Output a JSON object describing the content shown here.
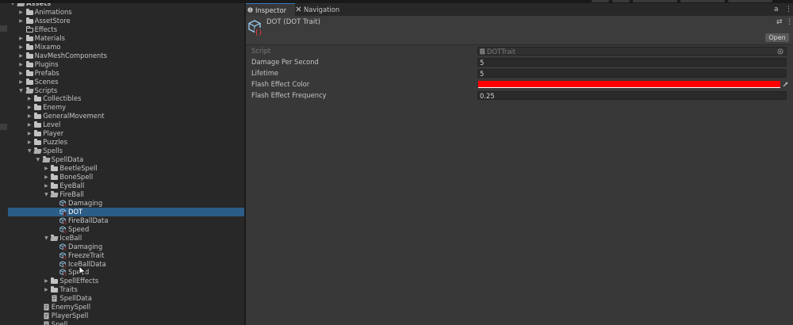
{
  "project": {
    "rows": [
      {
        "label": "Assets",
        "depth": 0,
        "arrow": "down",
        "icon": "folder-open-icon",
        "bold": true
      },
      {
        "label": "Animations",
        "depth": 1,
        "arrow": "right",
        "icon": "folder-icon"
      },
      {
        "label": "AssetStore",
        "depth": 1,
        "arrow": "right",
        "icon": "folder-icon"
      },
      {
        "label": "Effects",
        "depth": 1,
        "arrow": "",
        "icon": "folder-empty-icon"
      },
      {
        "label": "Materials",
        "depth": 1,
        "arrow": "right",
        "icon": "folder-icon"
      },
      {
        "label": "Mixamo",
        "depth": 1,
        "arrow": "right",
        "icon": "folder-icon"
      },
      {
        "label": "NavMeshComponents",
        "depth": 1,
        "arrow": "right",
        "icon": "folder-icon"
      },
      {
        "label": "Plugins",
        "depth": 1,
        "arrow": "right",
        "icon": "folder-icon"
      },
      {
        "label": "Prefabs",
        "depth": 1,
        "arrow": "right",
        "icon": "folder-icon"
      },
      {
        "label": "Scenes",
        "depth": 1,
        "arrow": "right",
        "icon": "folder-icon"
      },
      {
        "label": "Scripts",
        "depth": 1,
        "arrow": "down",
        "icon": "folder-open-icon"
      },
      {
        "label": "Collectibles",
        "depth": 2,
        "arrow": "right",
        "icon": "folder-icon"
      },
      {
        "label": "Enemy",
        "depth": 2,
        "arrow": "right",
        "icon": "folder-icon"
      },
      {
        "label": "GeneralMovement",
        "depth": 2,
        "arrow": "right",
        "icon": "folder-icon"
      },
      {
        "label": "Level",
        "depth": 2,
        "arrow": "right",
        "icon": "folder-icon"
      },
      {
        "label": "Player",
        "depth": 2,
        "arrow": "right",
        "icon": "folder-icon"
      },
      {
        "label": "Puzzles",
        "depth": 2,
        "arrow": "right",
        "icon": "folder-icon"
      },
      {
        "label": "Spells",
        "depth": 2,
        "arrow": "down",
        "icon": "folder-open-icon"
      },
      {
        "label": "SpellData",
        "depth": 3,
        "arrow": "down",
        "icon": "folder-open-icon"
      },
      {
        "label": "BeetleSpell",
        "depth": 4,
        "arrow": "right",
        "icon": "folder-icon"
      },
      {
        "label": "BoneSpell",
        "depth": 4,
        "arrow": "right",
        "icon": "folder-icon"
      },
      {
        "label": "EyeBall",
        "depth": 4,
        "arrow": "right",
        "icon": "folder-icon"
      },
      {
        "label": "FireBall",
        "depth": 4,
        "arrow": "down",
        "icon": "folder-open-icon"
      },
      {
        "label": "Damaging",
        "depth": 5,
        "arrow": "",
        "icon": "scriptable-object-icon"
      },
      {
        "label": "DOT",
        "depth": 5,
        "arrow": "",
        "icon": "scriptable-object-icon",
        "selected": true
      },
      {
        "label": "FireBallData",
        "depth": 5,
        "arrow": "",
        "icon": "scriptable-object-icon"
      },
      {
        "label": "Speed",
        "depth": 5,
        "arrow": "",
        "icon": "scriptable-object-icon"
      },
      {
        "label": "IceBall",
        "depth": 4,
        "arrow": "down",
        "icon": "folder-open-icon"
      },
      {
        "label": "Damaging",
        "depth": 5,
        "arrow": "",
        "icon": "scriptable-object-icon"
      },
      {
        "label": "FreezeTrait",
        "depth": 5,
        "arrow": "",
        "icon": "scriptable-object-icon"
      },
      {
        "label": "IceBallData",
        "depth": 5,
        "arrow": "",
        "icon": "scriptable-object-icon"
      },
      {
        "label": "Speed",
        "depth": 5,
        "arrow": "",
        "icon": "scriptable-object-icon"
      },
      {
        "label": "SpellEffects",
        "depth": 4,
        "arrow": "right",
        "icon": "folder-icon"
      },
      {
        "label": "Traits",
        "depth": 4,
        "arrow": "right",
        "icon": "folder-icon"
      },
      {
        "label": "SpellData",
        "depth": 4,
        "arrow": "",
        "icon": "script-icon"
      },
      {
        "label": "EnemySpell",
        "depth": 3,
        "arrow": "",
        "icon": "script-icon"
      },
      {
        "label": "PlayerSpell",
        "depth": 3,
        "arrow": "",
        "icon": "script-icon"
      },
      {
        "label": "Spell",
        "depth": 3,
        "arrow": "",
        "icon": "script-icon"
      }
    ]
  },
  "inspector": {
    "tabs": [
      {
        "label": "Inspector",
        "icon": "info-icon",
        "active": true
      },
      {
        "label": "Navigation",
        "icon": "navigation-icon",
        "active": false
      }
    ],
    "tab_right_lock": "a",
    "tab_right_menu": "⋮",
    "header_title": "DOT (DOT Trait)",
    "header_settings": "⇄",
    "header_menu": "⋮",
    "open_button": "Open",
    "fields": [
      {
        "label": "Script",
        "value": "DOTTrait",
        "kind": "script"
      },
      {
        "label": "Damage Per Second",
        "value": "5",
        "kind": "number"
      },
      {
        "label": "Lifetime",
        "value": "5",
        "kind": "number"
      },
      {
        "label": "Flash Effect Color",
        "value": "#FF0000",
        "kind": "color"
      },
      {
        "label": "Flash Effect Frequency",
        "value": "0.25",
        "kind": "number"
      }
    ]
  },
  "colors": {
    "selection": "#2c5d87",
    "flash_color": "#ff0000"
  }
}
